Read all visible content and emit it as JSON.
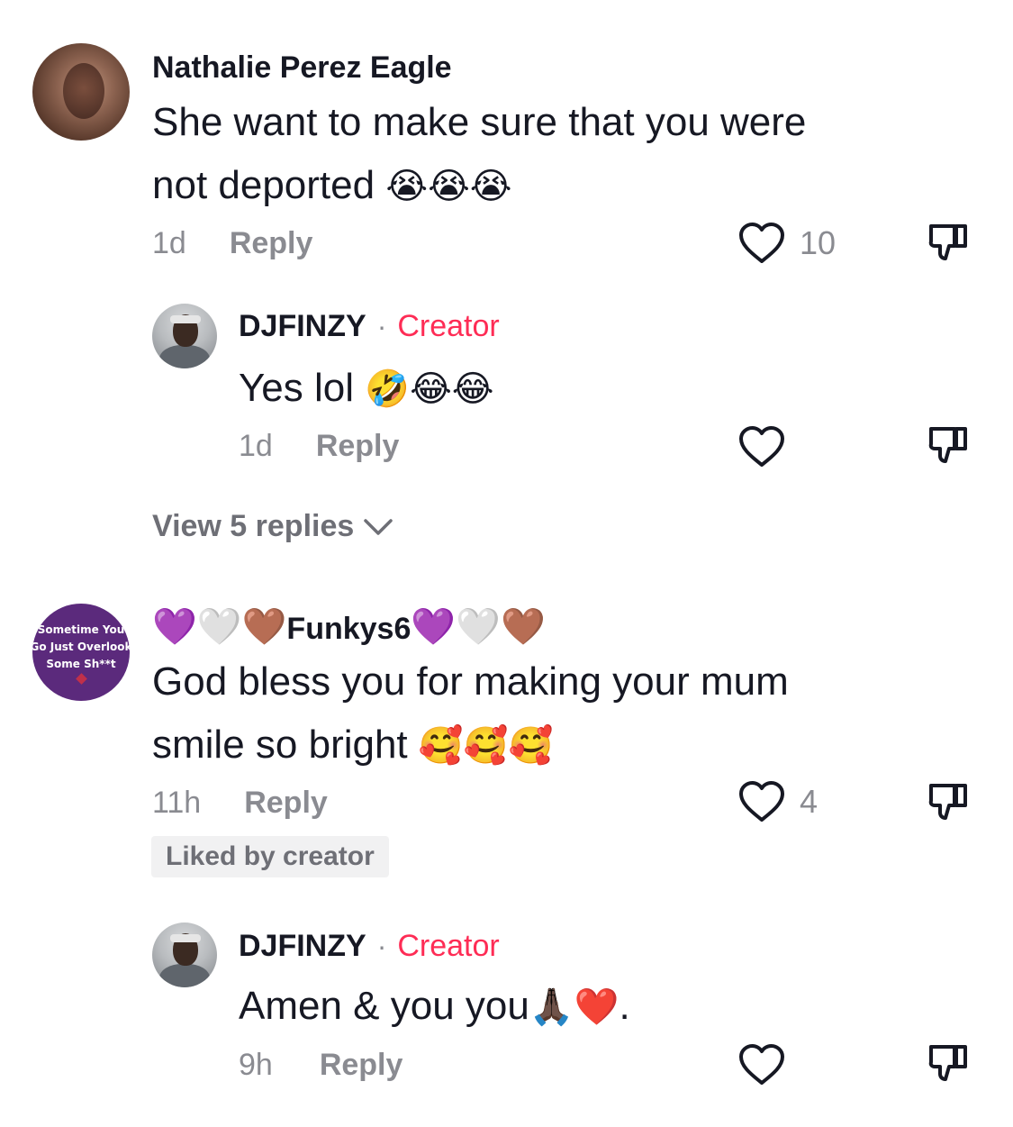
{
  "comments": [
    {
      "username": "Nathalie Perez Eagle",
      "text_line1": "She want to make sure that you were",
      "text_line2": "not deported",
      "emoji": "😭😭😭",
      "time": "1d",
      "reply_label": "Reply",
      "like_count": "10",
      "replies": [
        {
          "username": "DJFINZY",
          "separator": "·",
          "badge": "Creator",
          "text": "Yes lol",
          "emoji": "🤣😂😂",
          "time": "1d",
          "reply_label": "Reply"
        }
      ],
      "view_replies": "View 5 replies"
    },
    {
      "username_prefix_emoji": "💜🤍🤎",
      "username": "Funkys6",
      "username_suffix_emoji": "💜🤍🤎",
      "avatar_text": [
        "Sometime You",
        "Go Just Overlook",
        "Some Sh**t"
      ],
      "text_line1": "God bless you for making your mum",
      "text_line2": "smile so bright",
      "emoji": "🥰🥰🥰",
      "time": "11h",
      "reply_label": "Reply",
      "like_count": "4",
      "liked_by_creator": "Liked by creator",
      "replies": [
        {
          "username": "DJFINZY",
          "separator": "·",
          "badge": "Creator",
          "text": "Amen & you you",
          "emoji": "🙏🏿❤️",
          "trailing": ".",
          "time": "9h",
          "reply_label": "Reply"
        }
      ]
    }
  ],
  "icons": {
    "like": "heart-outline-icon",
    "dislike": "thumbs-down-icon",
    "expand": "chevron-down-icon"
  },
  "colors": {
    "creator_accent": "#fe2c55",
    "muted_text": "#8a8b91",
    "primary_text": "#161823",
    "badge_bg": "#f1f1f2"
  }
}
